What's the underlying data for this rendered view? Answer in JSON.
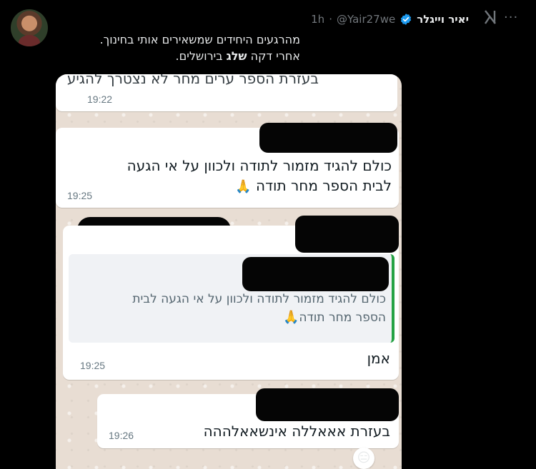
{
  "tweet": {
    "author_name": "יאיר וייגלר",
    "handle": "@Yair27we",
    "separator": "·",
    "time": "1h",
    "line1": "מהרגעים היחידים שמשאירים אותי בחינוך.",
    "line2_before": "אחרי דקה ",
    "line2_bold": "שלג",
    "line2_after": " בירושלים.",
    "more_label": "···"
  },
  "chat": {
    "msg0_partial": "בעזרת הספר ערים מחר לא נצטרך להגיע",
    "msg0_time": "19:22",
    "msg1_line1": "כולם להגיד מזמור לתודה ולכוון על אי הגעה",
    "msg1_line2": "לבית הספר מחר תודה",
    "msg1_emoji": "🙏",
    "msg1_time": "19:25",
    "quote_line1": "כולם להגיד מזמור לתודה ולכוון על אי הגעה לבית",
    "quote_line2": "הספר מחר תודה",
    "quote_emoji": "🙏",
    "msg2_text": "אמן",
    "msg2_time": "19:25",
    "msg3_text": "בעזרת אאאללה אינשאאלההה",
    "msg3_time": "19:26",
    "reaction_emoji": "😑"
  },
  "colors": {
    "verified": "#1d9bf0",
    "quote_bar": "#25a244",
    "chat_bg": "#e8ddd3"
  }
}
